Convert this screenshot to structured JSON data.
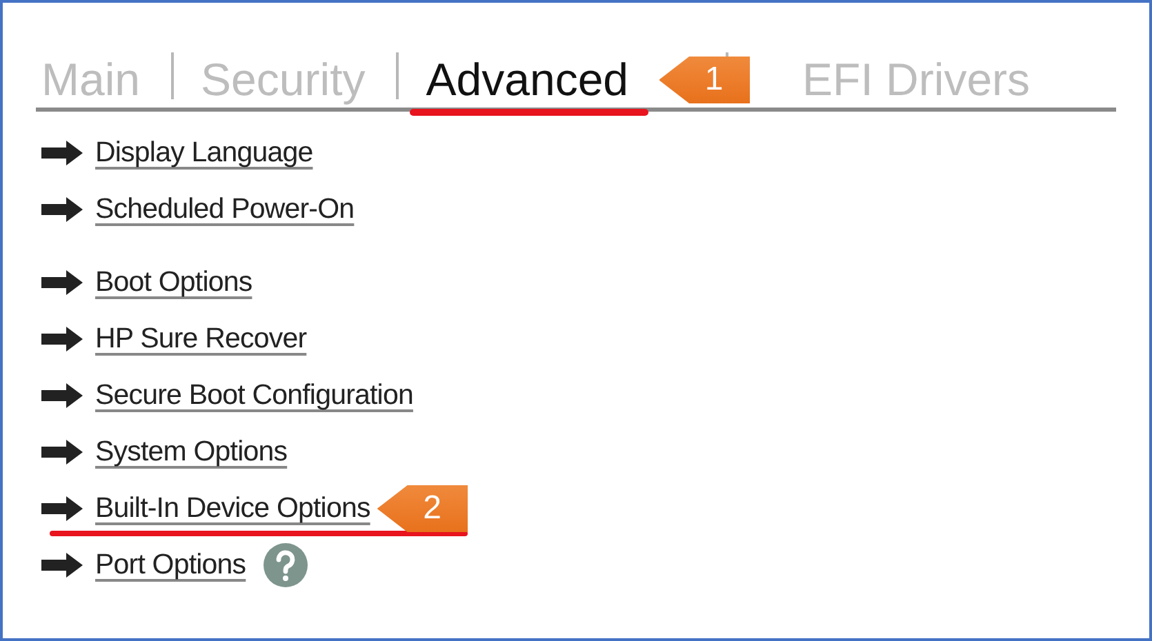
{
  "tabs": [
    {
      "label": "Main",
      "selected": false
    },
    {
      "label": "Security",
      "selected": false
    },
    {
      "label": "Advanced",
      "selected": true,
      "callout": "1"
    },
    {
      "label": "EFI Drivers",
      "selected": false
    }
  ],
  "groups": [
    {
      "items": [
        {
          "label": "Display Language",
          "highlighted": false,
          "help": false
        },
        {
          "label": "Scheduled Power-On",
          "highlighted": false,
          "help": false
        }
      ]
    },
    {
      "items": [
        {
          "label": "Boot Options",
          "highlighted": false,
          "help": false
        },
        {
          "label": "HP Sure Recover",
          "highlighted": false,
          "help": false
        },
        {
          "label": "Secure Boot Configuration",
          "highlighted": false,
          "help": false
        },
        {
          "label": "System Options",
          "highlighted": false,
          "help": false
        },
        {
          "label": "Built-In Device Options",
          "highlighted": true,
          "help": false,
          "callout": "2"
        },
        {
          "label": "Port Options",
          "highlighted": false,
          "help": true
        }
      ]
    }
  ]
}
